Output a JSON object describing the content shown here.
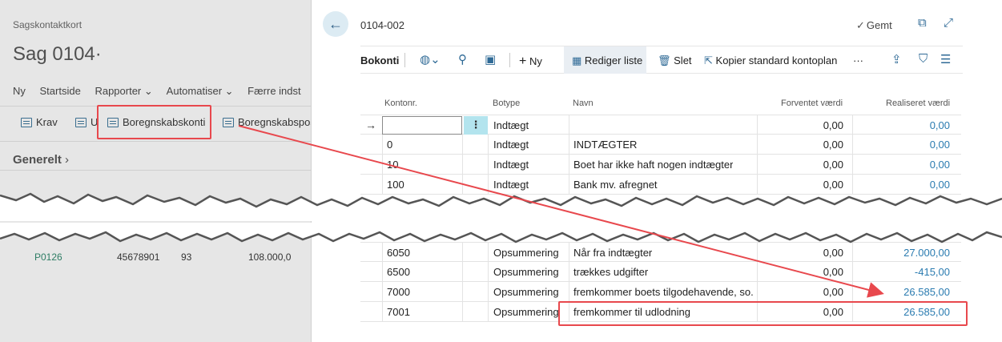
{
  "left": {
    "breadcrumb": "Sagskontaktkort",
    "title": "Sag 0104·",
    "menu": [
      "Ny",
      "Startside",
      "Rapporter ⌄",
      "Automatiser ⌄",
      "Færre indst"
    ],
    "actions": {
      "krav": "Krav",
      "u": "U",
      "boregnskabskonti": "Boregnskabskonti",
      "boregnskabspost": "Boregnskabspost"
    },
    "section": "Generelt",
    "lower_row": [
      "P0126",
      "45678901",
      "93",
      "108.000,0"
    ]
  },
  "right": {
    "doc_no": "0104-002",
    "saved": "Gemt",
    "toolbar": {
      "tab": "Bokonti",
      "ny": "Ny",
      "rediger": "Rediger liste",
      "slet": "Slet",
      "kopier": "Kopier standard kontoplan",
      "more": "···"
    },
    "columns": [
      "Kontonr.",
      "Botype",
      "Navn",
      "Forventet værdi",
      "Realiseret værdi"
    ],
    "rows_top": [
      {
        "kontonr": "",
        "botype": "Indtægt",
        "navn": "",
        "forventet": "0,00",
        "realiseret": "0,00"
      },
      {
        "kontonr": "0",
        "botype": "Indtægt",
        "navn": "INDTÆGTER",
        "forventet": "0,00",
        "realiseret": "0,00"
      },
      {
        "kontonr": "10",
        "botype": "Indtægt",
        "navn": "Boet har ikke haft nogen indtægter",
        "forventet": "0,00",
        "realiseret": "0,00"
      },
      {
        "kontonr": "100",
        "botype": "Indtægt",
        "navn": "Bank mv. afregnet",
        "forventet": "0,00",
        "realiseret": "0,00"
      }
    ],
    "rows_bottom": [
      {
        "kontonr": "6050",
        "botype": "Opsummering",
        "navn": "Når fra indtægter",
        "forventet": "0,00",
        "realiseret": "27.000,00"
      },
      {
        "kontonr": "6500",
        "botype": "Opsummering",
        "navn": "trækkes udgifter",
        "forventet": "0,00",
        "realiseret": "-415,00"
      },
      {
        "kontonr": "7000",
        "botype": "Opsummering",
        "navn": "fremkommer boets tilgodehavende, so...",
        "forventet": "0,00",
        "realiseret": "26.585,00"
      },
      {
        "kontonr": "7001",
        "botype": "Opsummering",
        "navn": "fremkommer til udlodning",
        "forventet": "0,00",
        "realiseret": "26.585,00"
      }
    ]
  },
  "colors": {
    "accent": "#2a7bb0",
    "highlight": "#e8484d",
    "selection": "#b3e4ee"
  }
}
